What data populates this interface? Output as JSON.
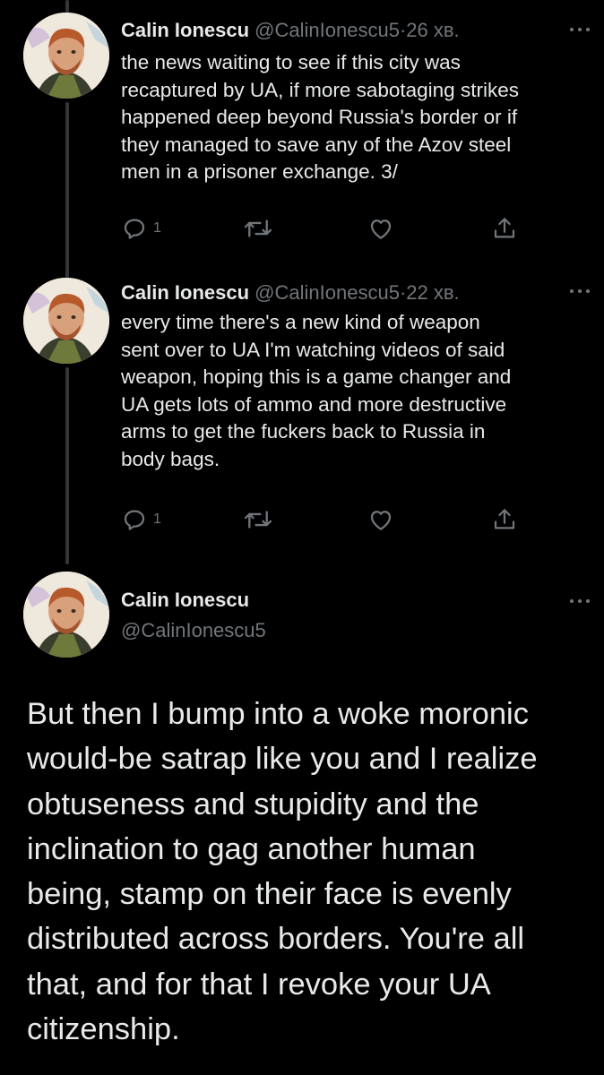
{
  "colors": {
    "background": "#000000",
    "text_primary": "#e7e9ea",
    "text_secondary": "#71767b",
    "thread_line": "#333639"
  },
  "tweets": [
    {
      "author_name": "Calin Ionescu",
      "author_handle": "@CalinIonescu5",
      "separator": "·",
      "time": "26 хв.",
      "text": "the news waiting to see if this city was\nrecaptured by UA, if more sabotaging strikes\nhappened deep beyond Russia's border or if\nthey managed to save any of the Azov steel\nmen in a prisoner exchange. 3/",
      "reply_count": "1",
      "icons": [
        "reply-icon",
        "retweet-icon",
        "like-icon",
        "share-icon"
      ]
    },
    {
      "author_name": "Calin Ionescu",
      "author_handle": "@CalinIonescu5",
      "separator": "·",
      "time": "22 хв.",
      "text": "every time there's a new kind of weapon\nsent over to UA I'm watching videos of said\nweapon, hoping this is a game changer and\nUA gets lots of ammo and more destructive\narms to get the fuckers back to Russia in\nbody bags.",
      "reply_count": "1",
      "icons": [
        "reply-icon",
        "retweet-icon",
        "like-icon",
        "share-icon"
      ]
    }
  ],
  "main_tweet": {
    "author_name": "Calin Ionescu",
    "author_handle": "@CalinIonescu5",
    "text": "But then I bump into a woke moronic\nwould-be satrap like you and I realize\nobtuseness and stupidity and the\ninclination to gag another human\nbeing, stamp on their face is evenly\ndistributed across borders. You're all\nthat, and for that I revoke your UA\ncitizenship."
  }
}
